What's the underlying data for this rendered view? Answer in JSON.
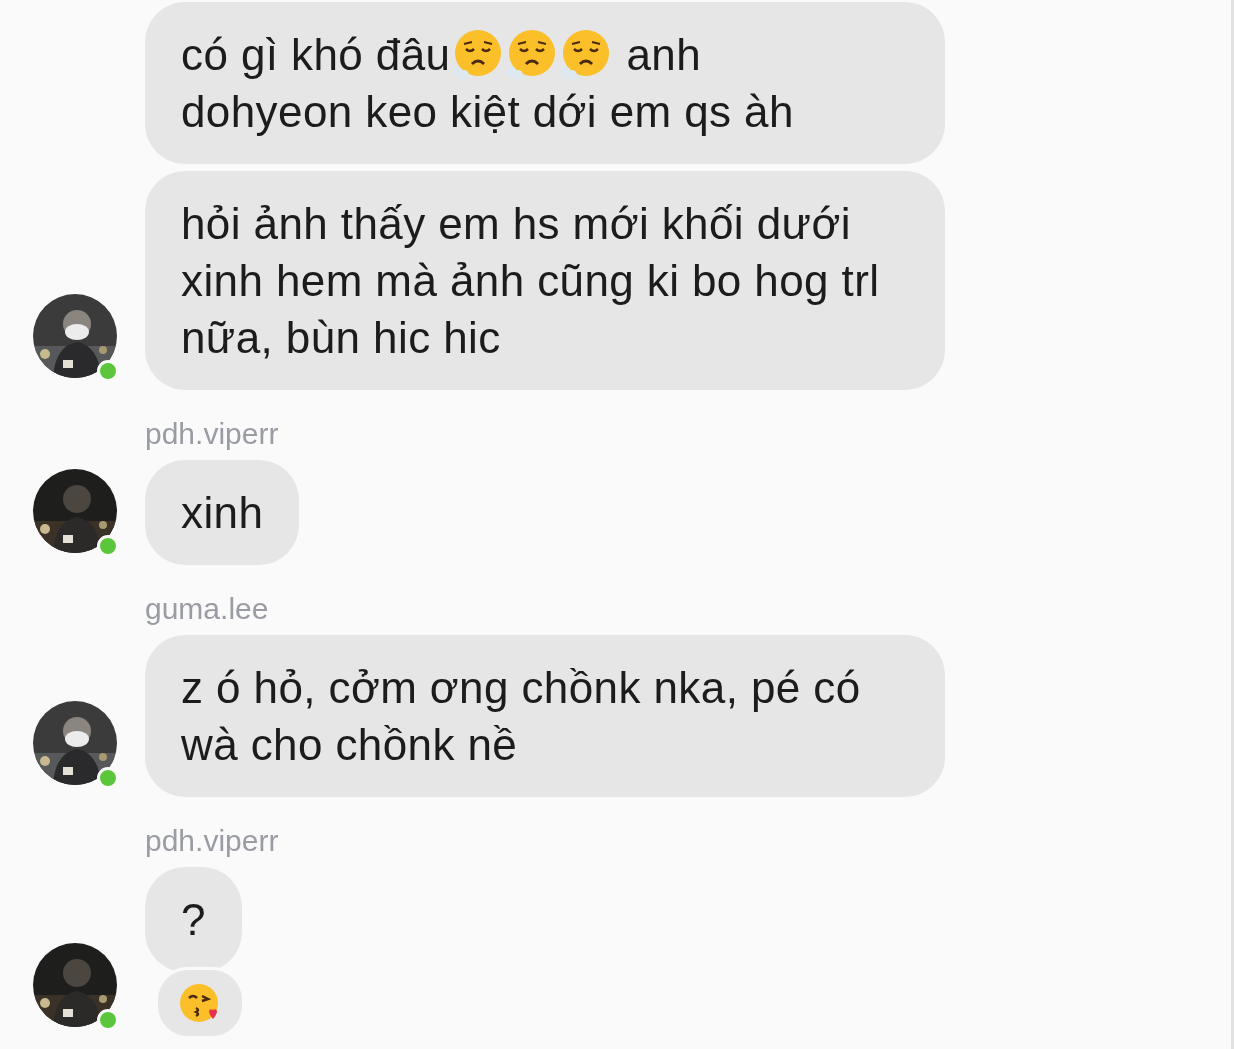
{
  "groups": [
    {
      "online": true,
      "messages": [
        {
          "parts": [
            {
              "kind": "text",
              "text": "có gì khó đâu"
            },
            {
              "kind": "sigh"
            },
            {
              "kind": "sigh"
            },
            {
              "kind": "sigh"
            },
            {
              "kind": "text",
              "text": "anh"
            },
            {
              "kind": "text",
              "text": "dohyeon keo kiệt dới em qs àh"
            }
          ]
        },
        {
          "parts": [
            {
              "kind": "text",
              "text": "hỏi ảnh thấy em hs mới khối dưới xinh hem mà ảnh cũng ki bo hog trl nữa, bùn hic hic"
            }
          ]
        }
      ]
    },
    {
      "sender": "pdh.viperr",
      "online": true,
      "messages": [
        {
          "parts": [
            {
              "kind": "text",
              "text": "xinh"
            }
          ]
        }
      ]
    },
    {
      "sender": "guma.lee",
      "online": true,
      "messages": [
        {
          "parts": [
            {
              "kind": "text",
              "text": "z ó hỏ, cởm ơng chồnk nka, pé có wà cho chồnk nề"
            }
          ]
        }
      ]
    },
    {
      "sender": "pdh.viperr",
      "online": true,
      "messages": [
        {
          "parts": [
            {
              "kind": "text",
              "text": "?"
            }
          ]
        }
      ],
      "reaction": {
        "kind": "kiss"
      }
    }
  ]
}
